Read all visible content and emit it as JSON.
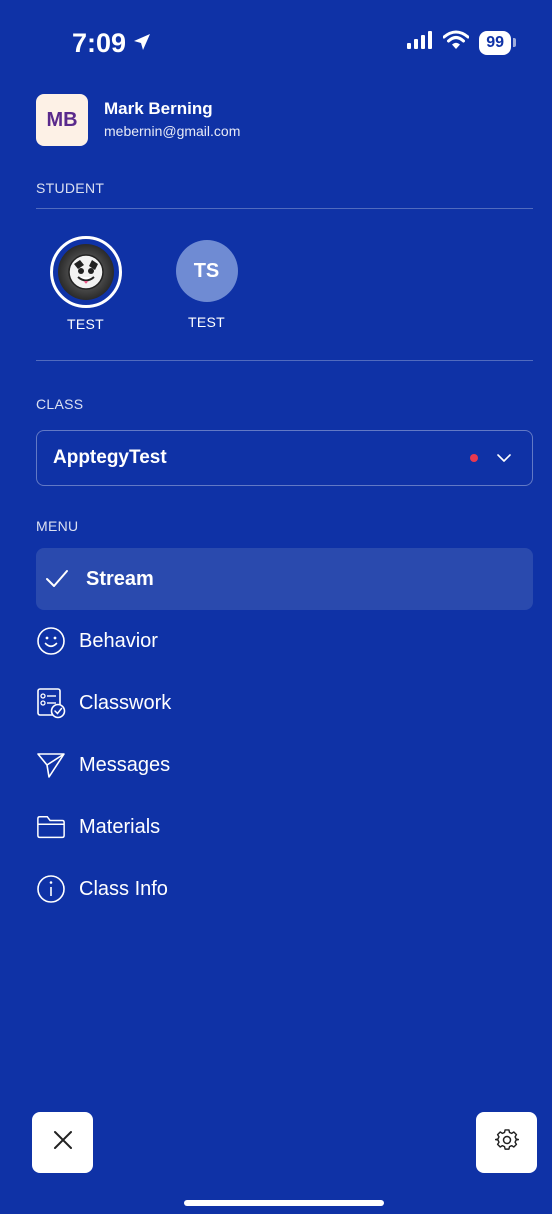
{
  "statusbar": {
    "time": "7:09",
    "battery": "99"
  },
  "profile": {
    "initials": "MB",
    "name": "Mark Berning",
    "email": "mebernin@gmail.com"
  },
  "student_section": {
    "label": "STUDENT",
    "students": [
      {
        "name": "TEST",
        "avatar": "photo"
      },
      {
        "name": "TEST",
        "initials": "TS"
      }
    ]
  },
  "class_section": {
    "label": "CLASS",
    "selected": "ApptegyTest"
  },
  "menu": {
    "label": "MENU",
    "items": [
      {
        "label": "Stream",
        "icon": "check-icon",
        "active": true
      },
      {
        "label": "Behavior",
        "icon": "smile-icon"
      },
      {
        "label": "Classwork",
        "icon": "checklist-icon"
      },
      {
        "label": "Messages",
        "icon": "send-icon"
      },
      {
        "label": "Materials",
        "icon": "folder-icon"
      },
      {
        "label": "Class Info",
        "icon": "info-icon"
      }
    ]
  },
  "colors": {
    "background": "#0f32a6",
    "active_item": "#2a4aae",
    "status_dot": "#e8384f",
    "initials_avatar": "#6f8bd3"
  }
}
